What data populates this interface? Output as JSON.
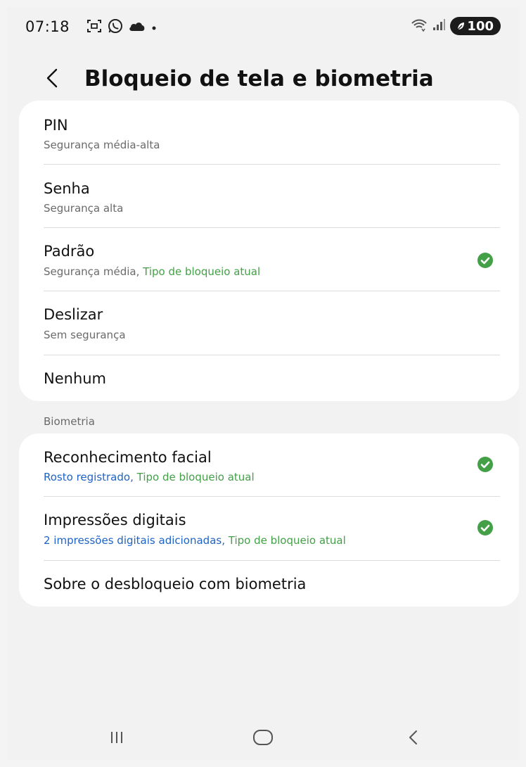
{
  "status_bar": {
    "time": "07:18",
    "battery": "100",
    "left_icons": [
      "screenshot-icon",
      "whatsapp-icon",
      "cloud-icon",
      "dot-icon"
    ],
    "right_icons": [
      "wifi-icon",
      "signal-icon",
      "battery-icon"
    ]
  },
  "header": {
    "title": "Bloqueio de tela e biometria",
    "back_icon": "back-arrow-icon"
  },
  "lock_types": [
    {
      "title": "PIN",
      "subtitle": "Segurança média-alta",
      "subtitle_extra": "",
      "selected": false
    },
    {
      "title": "Senha",
      "subtitle": "Segurança alta",
      "subtitle_extra": "",
      "selected": false
    },
    {
      "title": "Padrão",
      "subtitle": "Segurança média,",
      "subtitle_extra": "Tipo de bloqueio atual",
      "selected": true
    },
    {
      "title": "Deslizar",
      "subtitle": "Sem segurança",
      "subtitle_extra": "",
      "selected": false
    },
    {
      "title": "Nenhum",
      "subtitle": "",
      "subtitle_extra": "",
      "selected": false
    }
  ],
  "biometrics": {
    "section_label": "Biometria",
    "items": [
      {
        "title": "Reconhecimento facial",
        "subtitle": "Rosto registrado,",
        "subtitle_extra": "Tipo de bloqueio atual",
        "selected": true
      },
      {
        "title": "Impressões digitais",
        "subtitle": "2 impressões digitais adicionadas,",
        "subtitle_extra": "Tipo de bloqueio atual",
        "selected": true
      },
      {
        "title": "Sobre o desbloqueio com biometria",
        "subtitle": "",
        "subtitle_extra": "",
        "selected": false
      }
    ]
  },
  "nav_bar": {
    "buttons": [
      "recents-icon",
      "home-icon",
      "back-icon"
    ]
  },
  "colors": {
    "accent_green": "#43a047",
    "link_blue": "#1e63c6",
    "background": "#f2f2f2",
    "card": "#ffffff"
  }
}
